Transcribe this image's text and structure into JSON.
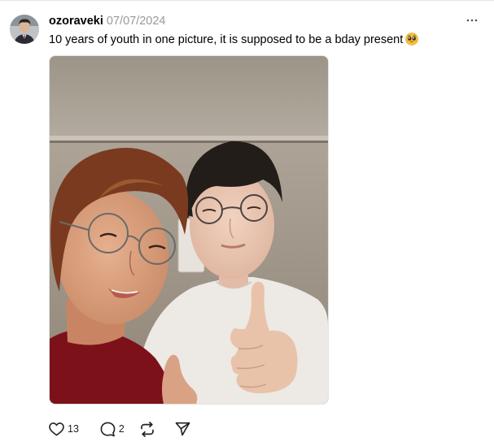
{
  "post": {
    "username": "ozoraveki",
    "date": "07/07/2024",
    "caption": "10 years of youth in one picture, it is supposed to be a bday present",
    "caption_emoji": "pleading-face-emoji",
    "media": {
      "alt": "Selfie of two young men with glasses; one gives a thumbs up"
    },
    "actions": {
      "like_count": "13",
      "comment_count": "2",
      "repost_count": "",
      "share_count": ""
    }
  },
  "icons": {
    "more": "more-horizontal-icon",
    "like": "heart-icon",
    "comment": "comment-bubble-icon",
    "repost": "repost-icon",
    "share": "send-icon"
  },
  "colors": {
    "text": "#000000",
    "muted": "#999999",
    "icon": "#222222"
  }
}
